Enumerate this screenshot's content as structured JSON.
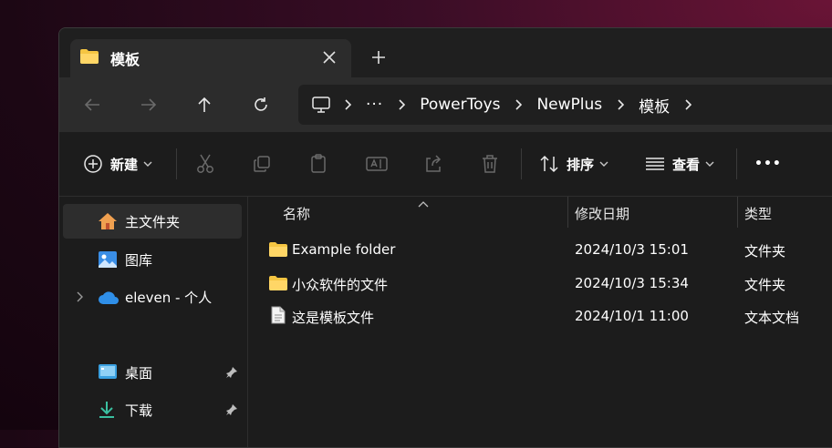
{
  "tab": {
    "title": "模板"
  },
  "address": {
    "more": "···",
    "segments": [
      "PowerToys",
      "NewPlus",
      "模板"
    ]
  },
  "toolbar": {
    "new_label": "新建",
    "sort_label": "排序",
    "view_label": "查看",
    "more": "•••"
  },
  "sidebar": {
    "items": [
      {
        "label": "主文件夹",
        "icon": "home-icon"
      },
      {
        "label": "图库",
        "icon": "gallery-icon"
      },
      {
        "label": "eleven - 个人",
        "icon": "onedrive-cloud-icon"
      },
      {
        "label": "桌面",
        "icon": "desktop-icon"
      },
      {
        "label": "下载",
        "icon": "download-icon"
      }
    ]
  },
  "columns": {
    "name": "名称",
    "modified": "修改日期",
    "type": "类型"
  },
  "files": [
    {
      "name": "Example folder",
      "modified": "2024/10/3 15:01",
      "type": "文件夹",
      "icon": "folder-icon"
    },
    {
      "name": "小众软件的文件",
      "modified": "2024/10/3 15:34",
      "type": "文件夹",
      "icon": "folder-icon"
    },
    {
      "name": "这是模板文件",
      "modified": "2024/10/1 11:00",
      "type": "文本文档",
      "icon": "text-document-icon"
    }
  ],
  "colors": {
    "folder": "#f5c542",
    "accent_blue": "#4aa3ff",
    "home_orange": "#f0a050"
  }
}
